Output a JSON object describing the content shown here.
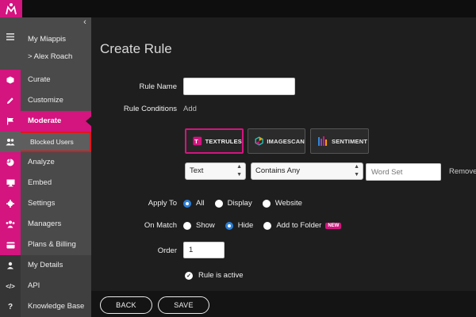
{
  "sidebar": {
    "user": {
      "line1": "My Miappis",
      "line2": "> Alex Roach"
    },
    "items": [
      {
        "label": "Curate",
        "icon": "cube-icon"
      },
      {
        "label": "Customize",
        "icon": "pencil-icon"
      },
      {
        "label": "Moderate",
        "icon": "flag-icon"
      },
      {
        "label": "Blocked Users",
        "icon": "users-icon"
      },
      {
        "label": "Analyze",
        "icon": "pie-chart-icon"
      },
      {
        "label": "Embed",
        "icon": "monitor-icon"
      },
      {
        "label": "Settings",
        "icon": "gear-icon"
      },
      {
        "label": "Managers",
        "icon": "group-icon"
      },
      {
        "label": "Plans & Billing",
        "icon": "credit-card-icon"
      },
      {
        "label": "My Details",
        "icon": "person-icon"
      },
      {
        "label": "API",
        "icon": "code-icon"
      },
      {
        "label": "Knowledge Base",
        "icon": "question-icon"
      }
    ]
  },
  "main": {
    "title": "Create Rule",
    "rule_name_label": "Rule Name",
    "rule_name_value": "",
    "rule_conditions_label": "Rule Conditions",
    "add_link": "Add",
    "tiles": [
      {
        "label": "TEXTRULES",
        "selected": true
      },
      {
        "label": "IMAGESCAN",
        "selected": false
      },
      {
        "label": "SENTIMENT",
        "selected": false
      }
    ],
    "condition": {
      "type": "Text",
      "operator": "Contains Any",
      "word_set_placeholder": "Word Set",
      "remove": "Remove"
    },
    "apply_to": {
      "label": "Apply To",
      "options": [
        "All",
        "Display",
        "Website"
      ],
      "selected": "All"
    },
    "on_match": {
      "label": "On Match",
      "options": [
        "Show",
        "Hide",
        "Add to Folder"
      ],
      "selected": "Hide",
      "badge": "NEW"
    },
    "order": {
      "label": "Order",
      "value": "1"
    },
    "active": {
      "label": "Rule is active",
      "checked": true
    },
    "buttons": {
      "back": "BACK",
      "save": "SAVE"
    }
  },
  "colors": {
    "accent": "#d4147f",
    "radio_selected": "#2a7fd8",
    "highlight_border": "#e0161e"
  }
}
